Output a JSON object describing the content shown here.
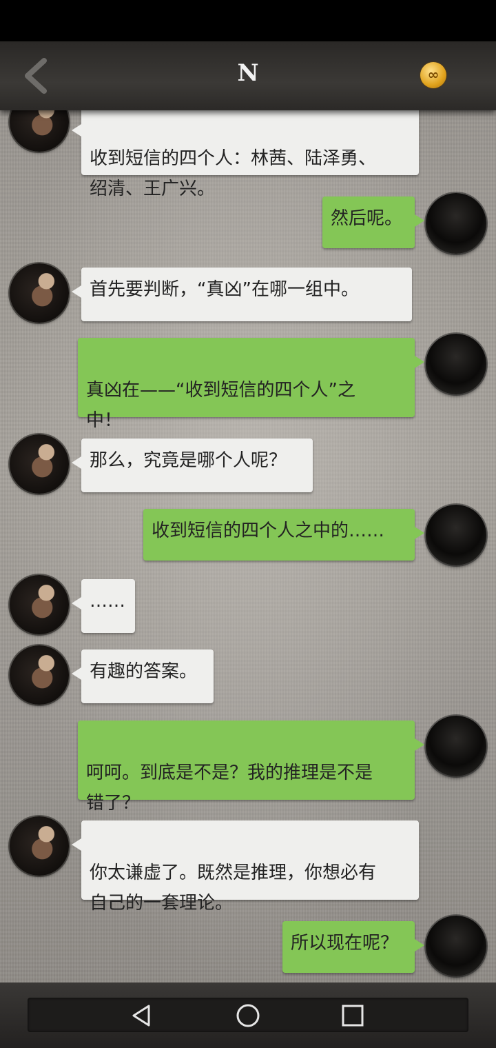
{
  "header": {
    "title": "N",
    "back_icon": "chevron-left-icon",
    "coin_symbol": "∞",
    "coin_icon": "infinity-coin-icon"
  },
  "messages": [
    {
      "side": "left",
      "text": "收到短信的四个人：林茜、陆泽勇、\n绍清、王广兴。"
    },
    {
      "side": "right",
      "text": "然后呢。"
    },
    {
      "side": "left",
      "text": "首先要判断，“真凶”在哪一组中。"
    },
    {
      "side": "right",
      "text": "真凶在——“收到短信的四个人”之\n中！"
    },
    {
      "side": "left",
      "text": "那么，究竟是哪个人呢？"
    },
    {
      "side": "right",
      "text": "收到短信的四个人之中的……"
    },
    {
      "side": "left",
      "text": "……"
    },
    {
      "side": "left",
      "text": "有趣的答案。"
    },
    {
      "side": "right",
      "text": "呵呵。到底是不是？我的推理是不是\n错了？"
    },
    {
      "side": "left",
      "text": "你太谦虚了。既然是推理，你想必有\n自己的一套理论。"
    },
    {
      "side": "right",
      "text": "所以现在呢？"
    }
  ],
  "nav": {
    "back_icon": "triangle-back-icon",
    "home_icon": "circle-home-icon",
    "recents_icon": "square-recents-icon"
  },
  "colors": {
    "right_bubble": "#84c656",
    "left_bubble": "#efefed",
    "top_bar": "#333130"
  }
}
